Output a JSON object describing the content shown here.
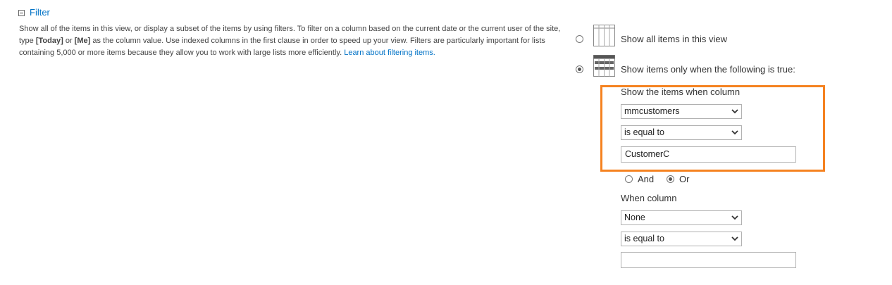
{
  "section": {
    "title": "Filter"
  },
  "description": {
    "part1": "Show all of the items in this view, or display a subset of the items by using filters. To filter on a column based on the current date or the current user of the site, type ",
    "today": "[Today]",
    "part2": " or ",
    "me": "[Me]",
    "part3": " as the column value. Use indexed columns in the first clause in order to speed up your view. Filters are particularly important for lists containing 5,000 or more items because they allow you to work with large lists more efficiently. ",
    "link": "Learn about filtering items."
  },
  "options": {
    "show_all": {
      "label": "Show all items in this view",
      "selected": false
    },
    "show_filtered": {
      "label": "Show items only when the following is true:",
      "selected": true
    }
  },
  "clause1": {
    "heading": "Show the items when column",
    "column": "mmcustomers",
    "operator": "is equal to",
    "value": "CustomerC"
  },
  "logic": {
    "and_label": "And",
    "or_label": "Or",
    "selected": "Or"
  },
  "clause2": {
    "heading": "When column",
    "column": "None",
    "operator": "is equal to",
    "value": ""
  },
  "colors": {
    "accent": "#0072c6",
    "highlight": "#f58220"
  }
}
